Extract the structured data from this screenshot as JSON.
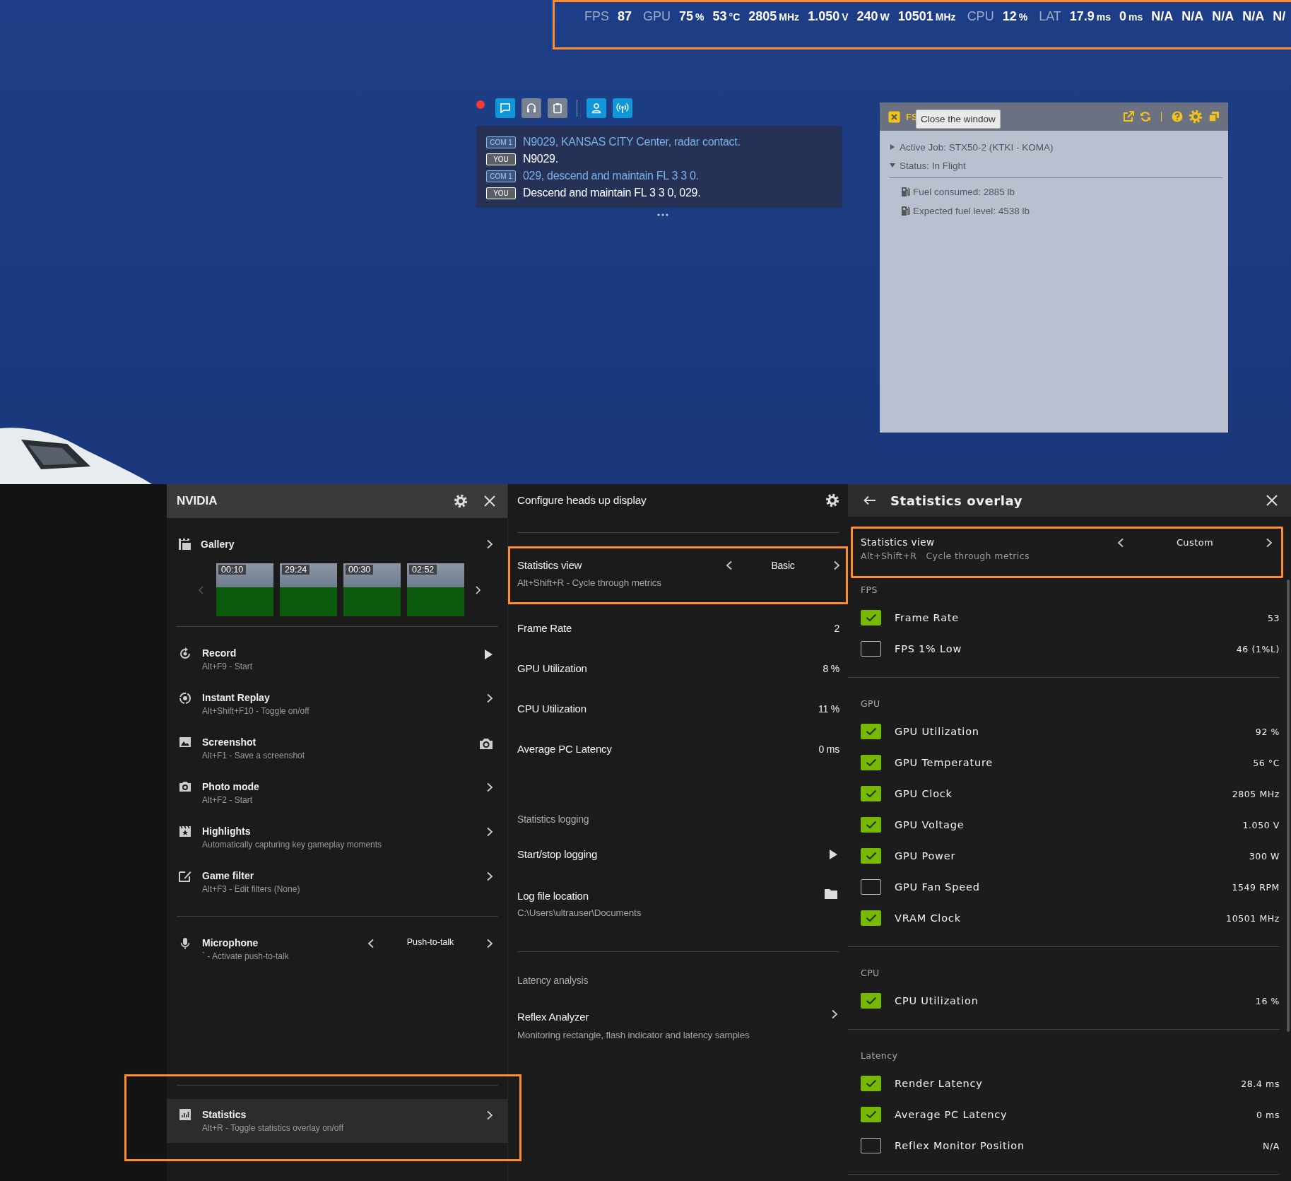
{
  "hud_overlay": {
    "highlighted": true,
    "tokens": [
      {
        "kind": "label",
        "text": "FPS"
      },
      {
        "kind": "value",
        "text": "87"
      },
      {
        "kind": "label",
        "text": "GPU"
      },
      {
        "kind": "value",
        "text": "75",
        "unit": "%"
      },
      {
        "kind": "value",
        "text": "53",
        "unit": "°C"
      },
      {
        "kind": "value",
        "text": "2805",
        "unit": "MHz"
      },
      {
        "kind": "value",
        "text": "1.050",
        "unit": "V"
      },
      {
        "kind": "value",
        "text": "240",
        "unit": "W"
      },
      {
        "kind": "value",
        "text": "10501",
        "unit": "MHz"
      },
      {
        "kind": "label",
        "text": "CPU"
      },
      {
        "kind": "value",
        "text": "12",
        "unit": "%"
      },
      {
        "kind": "label",
        "text": "LAT"
      },
      {
        "kind": "value",
        "text": "17.9",
        "unit": "ms"
      },
      {
        "kind": "value",
        "text": "0",
        "unit": "ms"
      },
      {
        "kind": "value",
        "text": "N/A"
      },
      {
        "kind": "value",
        "text": "N/A"
      },
      {
        "kind": "value",
        "text": "N/A"
      },
      {
        "kind": "value",
        "text": "N/A"
      },
      {
        "kind": "value",
        "text": "N/"
      }
    ]
  },
  "atc": {
    "recording": true,
    "toolbar": [
      {
        "kind": "chat",
        "active": true
      },
      {
        "kind": "headset",
        "active": false
      },
      {
        "kind": "clipboard",
        "active": false
      },
      {
        "kind": "person",
        "active": true
      },
      {
        "kind": "radio",
        "active": true
      }
    ],
    "messages": [
      {
        "kind": "atc",
        "source": "COM 1",
        "text": "N9029, KANSAS CITY Center, radar contact."
      },
      {
        "kind": "pilot",
        "source": "YOU",
        "text": "N9029."
      },
      {
        "kind": "atc",
        "source": "COM 1",
        "text": "029, descend and maintain FL 3 3 0."
      },
      {
        "kind": "pilot",
        "source": "YOU",
        "text": "Descend and maintain FL 3 3 0, 029."
      }
    ]
  },
  "job_window": {
    "title": "FS",
    "tooltip": "Close the window",
    "items": [
      {
        "text": "Active Job: STX50-2 (KTKI - KOMA)",
        "expanded": false
      },
      {
        "text": "Status: In Flight",
        "expanded": true,
        "children": [
          {
            "text": "Fuel consumed: 2885 lb"
          },
          {
            "text": "Expected fuel level: 4538 lb"
          }
        ]
      }
    ]
  },
  "nvidia_panel": {
    "title": "NVIDIA",
    "gallery": {
      "label": "Gallery",
      "thumbnails": [
        {
          "duration": "00:10"
        },
        {
          "duration": "29:24"
        },
        {
          "duration": "00:30"
        },
        {
          "duration": "02:52"
        }
      ]
    },
    "items": [
      {
        "title": "Record",
        "subtitle": "Alt+F9 - Start",
        "selected": false
      },
      {
        "title": "Instant Replay",
        "subtitle": "Alt+Shift+F10 - Toggle on/off",
        "selected": false
      },
      {
        "title": "Screenshot",
        "subtitle": "Alt+F1 - Save a screenshot",
        "selected": false
      },
      {
        "title": "Photo mode",
        "subtitle": "Alt+F2 - Start",
        "selected": false
      },
      {
        "title": "Highlights",
        "subtitle": "Automatically capturing key gameplay moments",
        "selected": false
      },
      {
        "title": "Game filter",
        "subtitle": "Alt+F3 - Edit filters (None)",
        "selected": false
      }
    ],
    "microphone": {
      "title": "Microphone",
      "subtitle": "` - Activate push-to-talk",
      "value": "Push-to-talk"
    },
    "footer_item": {
      "title": "Statistics",
      "subtitle": "Alt+R - Toggle statistics overlay on/off",
      "selected": true,
      "highlighted": true
    }
  },
  "hud_config": {
    "title": "Configure heads up display",
    "statistics_view": {
      "title": "Statistics view",
      "subtitle": "Alt+Shift+R - Cycle through metrics",
      "value": "Basic",
      "highlighted": true
    },
    "metrics": [
      {
        "name": "Frame Rate",
        "value": "2"
      },
      {
        "name": "GPU Utilization",
        "value": "8 %"
      },
      {
        "name": "CPU Utilization",
        "value": "11 %"
      },
      {
        "name": "Average PC Latency",
        "value": "0 ms"
      }
    ],
    "logging": {
      "heading": "Statistics logging",
      "start_stop": "Start/stop logging",
      "log_file": {
        "title": "Log file location",
        "path": "C:\\Users\\ultrauser\\Documents"
      }
    },
    "latency": {
      "heading": "Latency analysis",
      "reflex": {
        "title": "Reflex Analyzer",
        "subtitle": "Monitoring rectangle, flash indicator and latency samples"
      }
    }
  },
  "stats_overlay": {
    "title": "Statistics overlay",
    "statistics_view": {
      "title": "Statistics view",
      "subtitle": "Alt+Shift+R   Cycle through metrics",
      "value": "Custom",
      "highlighted": true
    },
    "groups": [
      {
        "heading": "FPS",
        "metrics": [
          {
            "name": "Frame Rate",
            "value": "53",
            "checked": true
          },
          {
            "name": "FPS 1% Low",
            "value": "46 (1%L)",
            "checked": false
          }
        ]
      },
      {
        "heading": "GPU",
        "metrics": [
          {
            "name": "GPU Utilization",
            "value": "92 %",
            "checked": true
          },
          {
            "name": "GPU Temperature",
            "value": "56 °C",
            "checked": true
          },
          {
            "name": "GPU Clock",
            "value": "2805 MHz",
            "checked": true
          },
          {
            "name": "GPU Voltage",
            "value": "1.050 V",
            "checked": true
          },
          {
            "name": "GPU Power",
            "value": "300 W",
            "checked": true
          },
          {
            "name": "GPU Fan Speed",
            "value": "1549 RPM",
            "checked": false
          },
          {
            "name": "VRAM Clock",
            "value": "10501 MHz",
            "checked": true
          }
        ]
      },
      {
        "heading": "CPU",
        "metrics": [
          {
            "name": "CPU Utilization",
            "value": "16 %",
            "checked": true
          }
        ]
      },
      {
        "heading": "Latency",
        "metrics": [
          {
            "name": "Render Latency",
            "value": "28.4 ms",
            "checked": true
          },
          {
            "name": "Average PC Latency",
            "value": "0 ms",
            "checked": true
          },
          {
            "name": "Reflex Monitor Position",
            "value": "N/A",
            "checked": false
          }
        ]
      }
    ]
  }
}
